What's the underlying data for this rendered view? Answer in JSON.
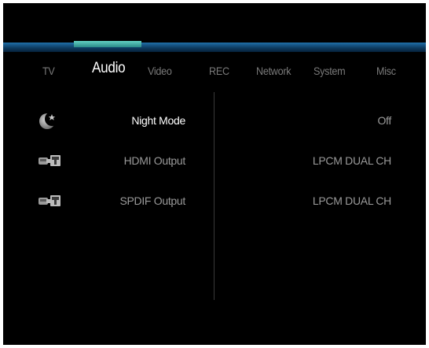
{
  "tabs": [
    {
      "label": "TV"
    },
    {
      "label": "Audio"
    },
    {
      "label": "Video"
    },
    {
      "label": "REC"
    },
    {
      "label": "Network"
    },
    {
      "label": "System"
    },
    {
      "label": "Misc"
    }
  ],
  "active_tab": "Audio",
  "settings": [
    {
      "label": "Night Mode",
      "value": "Off",
      "icon": "night-mode-icon"
    },
    {
      "label": "HDMI Output",
      "value": "LPCM DUAL CH",
      "icon": "hdmi-output-icon"
    },
    {
      "label": "SPDIF Output",
      "value": "LPCM DUAL CH",
      "icon": "spdif-output-icon"
    }
  ],
  "colors": {
    "background": "#000000",
    "accent_bar": "#1f6fa8",
    "active_tab_marker": "#62d0c2",
    "inactive_text": "#9a9a9a",
    "active_text": "#ffffff"
  }
}
